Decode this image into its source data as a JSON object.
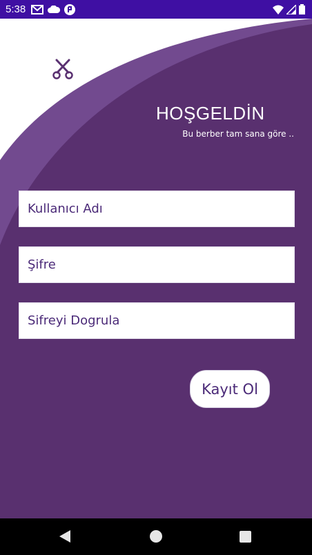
{
  "status_bar": {
    "time": "5:38",
    "background": "#3f0fa3"
  },
  "app": {
    "welcome_title": "HOŞGELDİN",
    "tagline": "Bu berber tam sana göre ..",
    "primary_color": "#5a3171",
    "logo_icon": "scissors-icon"
  },
  "form": {
    "username_placeholder": "Kullanıcı Adı",
    "password_placeholder": "Şifre",
    "confirm_password_placeholder": "Sifreyi Dogrula",
    "register_label": "Kayıt Ol"
  },
  "nav_bar": {
    "back": "back-icon",
    "home": "home-icon",
    "recents": "recents-icon"
  }
}
